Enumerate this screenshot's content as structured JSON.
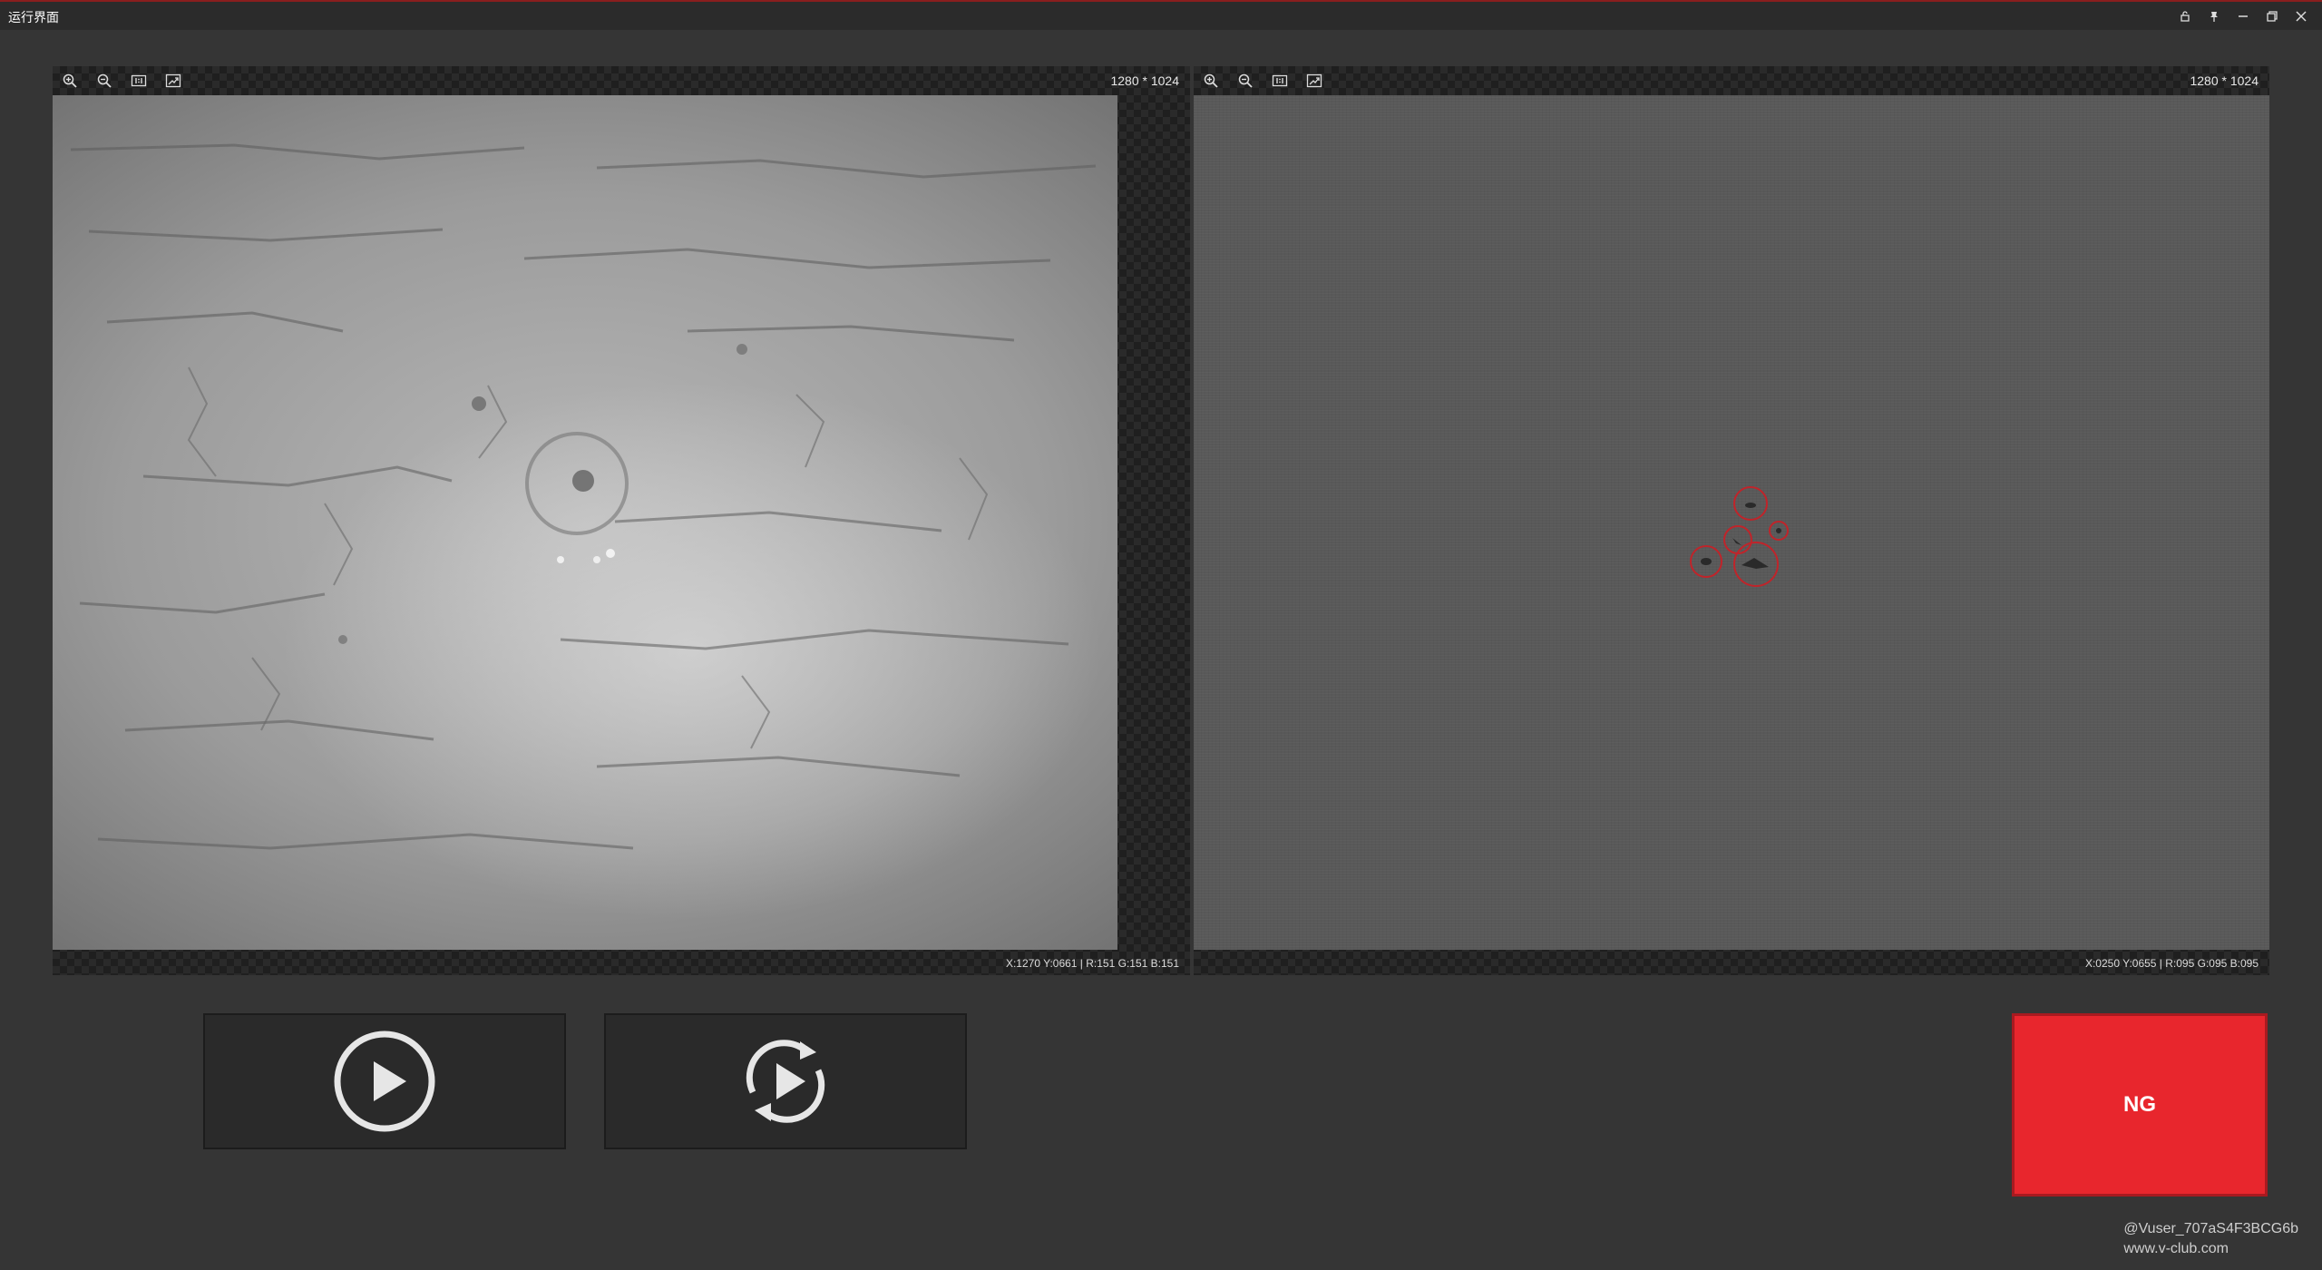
{
  "window": {
    "title": "运行界面",
    "controls": [
      "lock-icon",
      "pin-icon",
      "minimize-icon",
      "restore-icon",
      "close-icon"
    ]
  },
  "viewers": {
    "left": {
      "toolbar": [
        "zoom-in-icon",
        "zoom-out-icon",
        "actual-size-icon",
        "fit-window-icon"
      ],
      "resolution": "1280 * 1024",
      "status": "X:1270  Y:0661  |  R:151  G:151  B:151"
    },
    "right": {
      "toolbar": [
        "zoom-in-icon",
        "zoom-out-icon",
        "actual-size-icon",
        "fit-window-icon"
      ],
      "resolution": "1280 * 1024",
      "status": "X:0250  Y:0655  |  R:095  G:095  B:095"
    }
  },
  "controls": {
    "run_icon": "play-icon",
    "loop_icon": "loop-play-icon"
  },
  "result": {
    "label": "NG",
    "color": "#e8262d"
  },
  "watermark": {
    "line1": "@Vuser_707aS4F3BCG6b",
    "line2": "www.v-club.com"
  }
}
